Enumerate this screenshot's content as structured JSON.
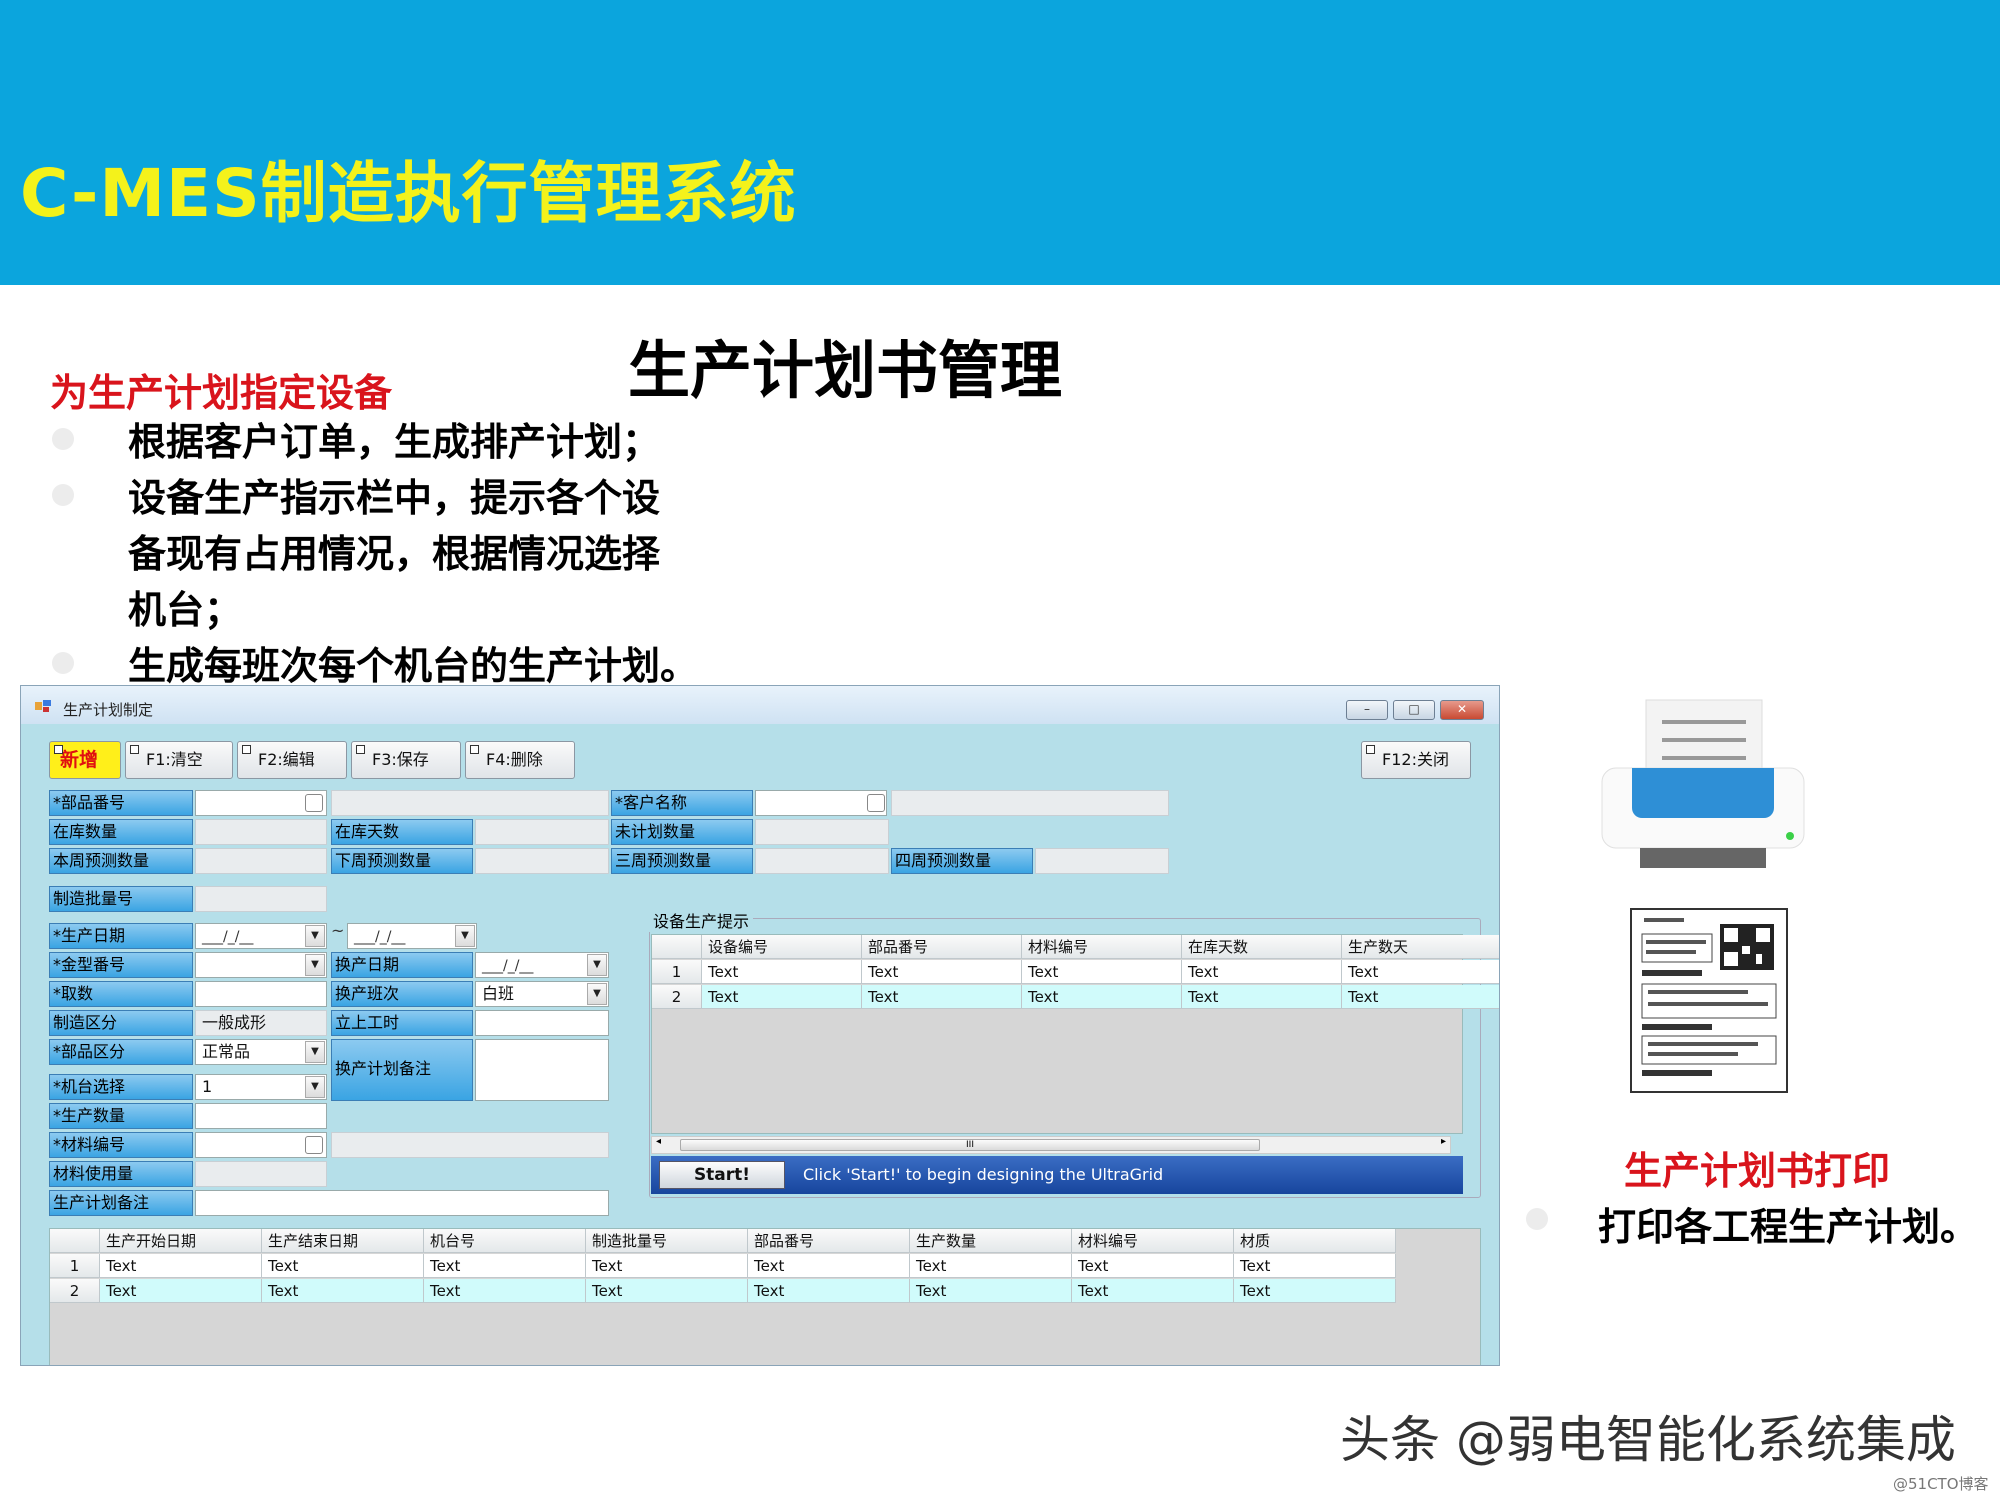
{
  "header": {
    "title": "C-MES制造执行管理系统"
  },
  "main_title": "生产计划书管理",
  "section": {
    "title": "为生产计划指定设备",
    "bullets": [
      "根据客户订单，生成排产计划；",
      "设备生产指示栏中，提示各个设",
      "备现有占用情况，根据情况选择",
      "机台；",
      "生成每班次每个机台的生产计划。"
    ]
  },
  "window": {
    "title": "生产计划制定",
    "controls": {
      "minimize": "–",
      "maximize": "□",
      "close": "✕"
    },
    "toolbar": {
      "new": "新增",
      "clear": "F1:清空",
      "edit": "F2:编辑",
      "save": "F3:保存",
      "delete": "F4:删除",
      "close": "F12:关闭"
    },
    "form": {
      "part_no": "*部品番号",
      "stock_qty": "在库数量",
      "stock_days": "在库天数",
      "customer_name": "*客户名称",
      "unplanned_qty": "未计划数量",
      "week1_forecast": "本周预测数量",
      "week2_forecast": "下周预测数量",
      "week3_forecast": "三周预测数量",
      "week4_forecast": "四周预测数量",
      "batch_no": "制造批量号",
      "prod_date": "*生产日期",
      "date_placeholder": "___/_/__",
      "tilde": "~",
      "mold_no": "*金型番号",
      "change_date": "换产日期",
      "cavity": "*取数",
      "change_shift": "换产班次",
      "change_shift_value": "白班",
      "mfg_type": "制造区分",
      "mfg_type_value": "一般成形",
      "setup_time": "立上工时",
      "part_type": "*部品区分",
      "part_type_value": "正常品",
      "change_note": "换产计划备注",
      "machine": "*机台选择",
      "machine_value": "1",
      "prod_qty": "*生产数量",
      "material_no": "*材料编号",
      "material_usage": "材料使用量",
      "plan_note": "生产计划备注"
    },
    "equipment": {
      "group_title": "设备生产提示",
      "columns": [
        "设备编号",
        "部品番号",
        "材料编号",
        "在库天数",
        "生产数天"
      ],
      "rows": [
        {
          "num": "1",
          "cells": [
            "Text",
            "Text",
            "Text",
            "Text",
            "Text"
          ]
        },
        {
          "num": "2",
          "cells": [
            "Text",
            "Text",
            "Text",
            "Text",
            "Text"
          ]
        }
      ],
      "scroll_grip": "III",
      "start_button": "Start!",
      "start_hint": "Click 'Start!' to begin designing the UltraGrid"
    },
    "plan_grid": {
      "columns": [
        "生产开始日期",
        "生产结束日期",
        "机台号",
        "制造批量号",
        "部品番号",
        "生产数量",
        "材料编号",
        "材质"
      ],
      "rows": [
        {
          "num": "1",
          "cells": [
            "Text",
            "Text",
            "Text",
            "Text",
            "Text",
            "Text",
            "Text",
            "Text"
          ]
        },
        {
          "num": "2",
          "cells": [
            "Text",
            "Text",
            "Text",
            "Text",
            "Text",
            "Text",
            "Text",
            "Text"
          ]
        }
      ]
    }
  },
  "print": {
    "title": "生产计划书打印",
    "desc": "打印各工程生产计划。"
  },
  "watermark": "头条 @弱电智能化系统集成",
  "credit": "@51CTO博客",
  "colors": {
    "header_bg": "#0ba5dd",
    "header_title": "#f4f21b",
    "accent_red": "#d9141c",
    "window_bg": "#b5dfe9",
    "row_alt": "#d0fbfb"
  },
  "icons": [
    "printer-icon",
    "receipt-qr-icon",
    "app-window-icon"
  ]
}
